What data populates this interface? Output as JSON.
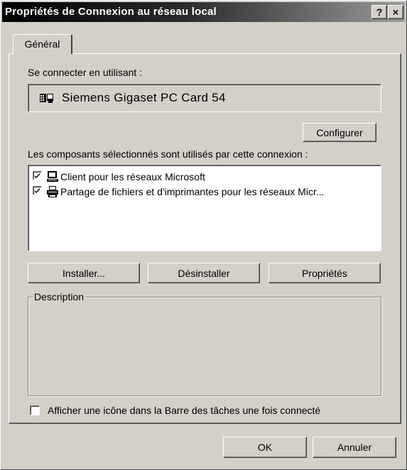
{
  "window": {
    "title": "Propriétés de Connexion au réseau local",
    "help_button": "?",
    "close_button": "×"
  },
  "tabs": [
    {
      "label": "Général",
      "selected": true
    }
  ],
  "connect_using": {
    "label": "Se connecter en utilisant :",
    "adapter_name": "Siemens Gigaset PC Card 54",
    "adapter_icon": "network-card-icon",
    "configure_button": "Configurer"
  },
  "components": {
    "label": "Les composants sélectionnés sont utilisés par cette connexion :",
    "items": [
      {
        "label": "Client pour les réseaux Microsoft",
        "checked": true,
        "icon": "network-client-icon"
      },
      {
        "label": "Partage de fichiers et d'imprimantes pour les réseaux Micr...",
        "checked": true,
        "icon": "file-printer-sharing-icon"
      }
    ]
  },
  "actions": {
    "install": "Installer...",
    "uninstall": "Désinstaller",
    "properties": "Propriétés"
  },
  "description": {
    "legend": "Description",
    "text": ""
  },
  "taskbar_option": {
    "label": "Afficher une icône dans la Barre des tâches une fois connecté",
    "checked": false
  },
  "footer": {
    "ok": "OK",
    "cancel": "Annuler"
  }
}
